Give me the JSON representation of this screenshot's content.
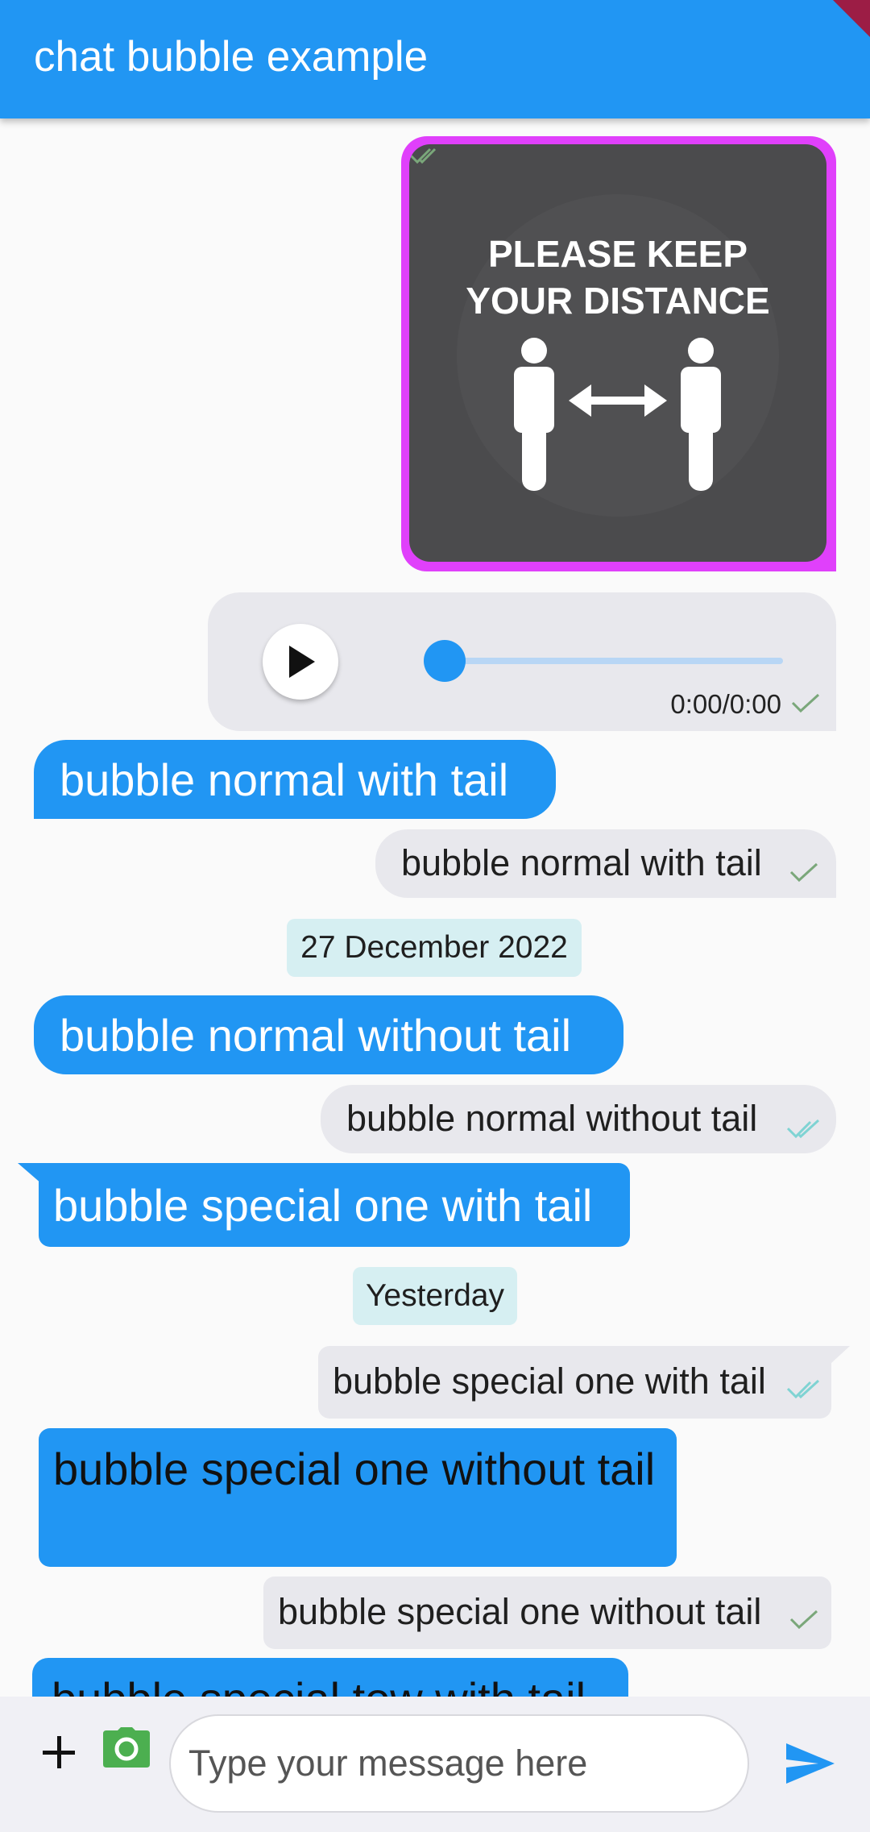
{
  "app": {
    "title": "chat bubble example"
  },
  "colors": {
    "primary": "#2196f3",
    "bubble_grey": "#e8e8ed",
    "date_chip": "#d6eff2",
    "image_border": "#e040fb"
  },
  "image_message": {
    "line1": "PLEASE KEEP",
    "line2": "YOUR DISTANCE",
    "status_icon": "double-check-icon"
  },
  "audio_message": {
    "time": "0:00/0:00",
    "play_icon": "play-icon",
    "status_icon": "check-icon",
    "progress": 0
  },
  "messages": [
    {
      "text": "bubble normal with tail",
      "side": "left"
    },
    {
      "text": "bubble normal with tail",
      "side": "right",
      "status": "sent"
    },
    {
      "text": "bubble normal without tail",
      "side": "left"
    },
    {
      "text": "bubble normal without tail",
      "side": "right",
      "status": "seen"
    },
    {
      "text": "bubble special one with tail",
      "side": "left"
    },
    {
      "text": "bubble special one with tail",
      "side": "right",
      "status": "seen"
    },
    {
      "text": "bubble special one without tail",
      "side": "left"
    },
    {
      "text": "bubble special one without tail",
      "side": "right",
      "status": "sent"
    },
    {
      "text": "bubble special tow with tail",
      "side": "left"
    }
  ],
  "dates": [
    "27 December 2022",
    "Yesterday"
  ],
  "input_bar": {
    "placeholder": "Type your message here",
    "add_icon": "plus-icon",
    "camera_icon": "camera-icon",
    "send_icon": "send-icon"
  }
}
